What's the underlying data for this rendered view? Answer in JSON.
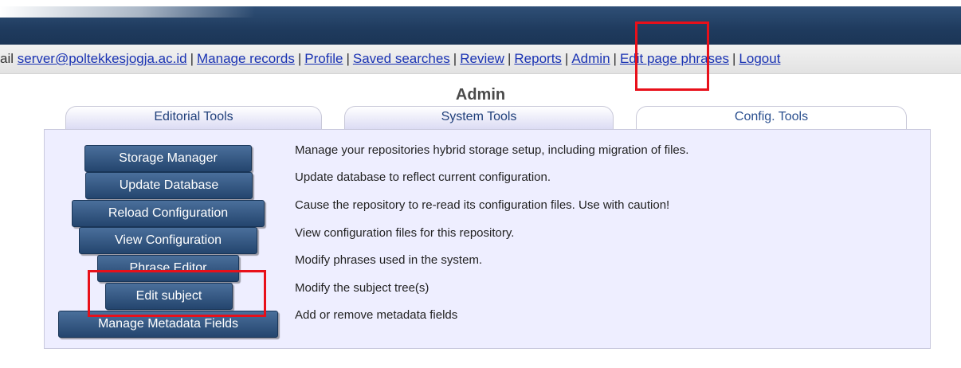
{
  "userbar": {
    "prefix": "ail ",
    "email": "server@poltekkesjogja.ac.id",
    "links": [
      "Manage records",
      "Profile",
      "Saved searches",
      "Review",
      "Reports",
      "Admin",
      "Edit page phrases",
      "Logout"
    ]
  },
  "page": {
    "title": "Admin"
  },
  "tabs": {
    "editorial": "Editorial Tools",
    "system": "System Tools",
    "config": "Config. Tools",
    "selected": "Config. Tools"
  },
  "tools": [
    {
      "label": "Storage Manager",
      "description": "Manage your repositories hybrid storage setup, including migration of files."
    },
    {
      "label": "Update Database",
      "description": "Update database to reflect current configuration."
    },
    {
      "label": "Reload Configuration",
      "description": "Cause the repository to re-read its configuration files. Use with caution!"
    },
    {
      "label": "View Configuration",
      "description": "View configuration files for this repository."
    },
    {
      "label": "Phrase Editor",
      "description": "Modify phrases used in the system."
    },
    {
      "label": "Edit subject",
      "description": "Modify the subject tree(s)"
    },
    {
      "label": "Manage Metadata Fields",
      "description": "Add or remove metadata fields"
    }
  ],
  "colors": {
    "header": "#1f3b5e",
    "button": "#2c4f7a",
    "panel": "#eeeeff",
    "highlight": "#e8101a",
    "link": "#1a33b3"
  }
}
